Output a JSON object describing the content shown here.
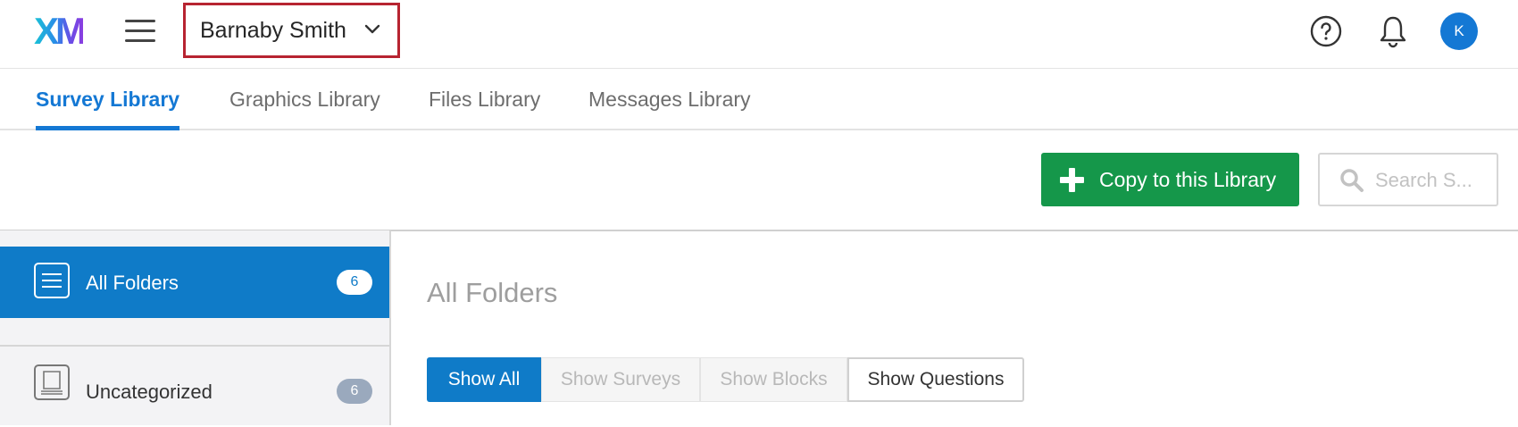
{
  "header": {
    "logo_text": "XM",
    "account_name": "Barnaby Smith",
    "avatar_initial": "K",
    "accent_color": "#1478d4",
    "highlight_color": "#b72431"
  },
  "tabs": [
    {
      "label": "Survey Library",
      "active": true
    },
    {
      "label": "Graphics Library",
      "active": false
    },
    {
      "label": "Files Library",
      "active": false
    },
    {
      "label": "Messages Library",
      "active": false
    }
  ],
  "toolbar": {
    "copy_label": "Copy to this Library",
    "copy_color": "#15974a",
    "search_placeholder": "Search S..."
  },
  "sidebar": {
    "folders": [
      {
        "label": "All Folders",
        "count": "6",
        "selected": true
      },
      {
        "label": "Uncategorized",
        "count": "6",
        "selected": false
      }
    ]
  },
  "main": {
    "title": "All Folders",
    "filters": [
      {
        "label": "Show All",
        "active": true
      },
      {
        "label": "Show Surveys",
        "active": false
      },
      {
        "label": "Show Blocks",
        "active": false
      },
      {
        "label": "Show Questions",
        "active": false
      }
    ]
  }
}
